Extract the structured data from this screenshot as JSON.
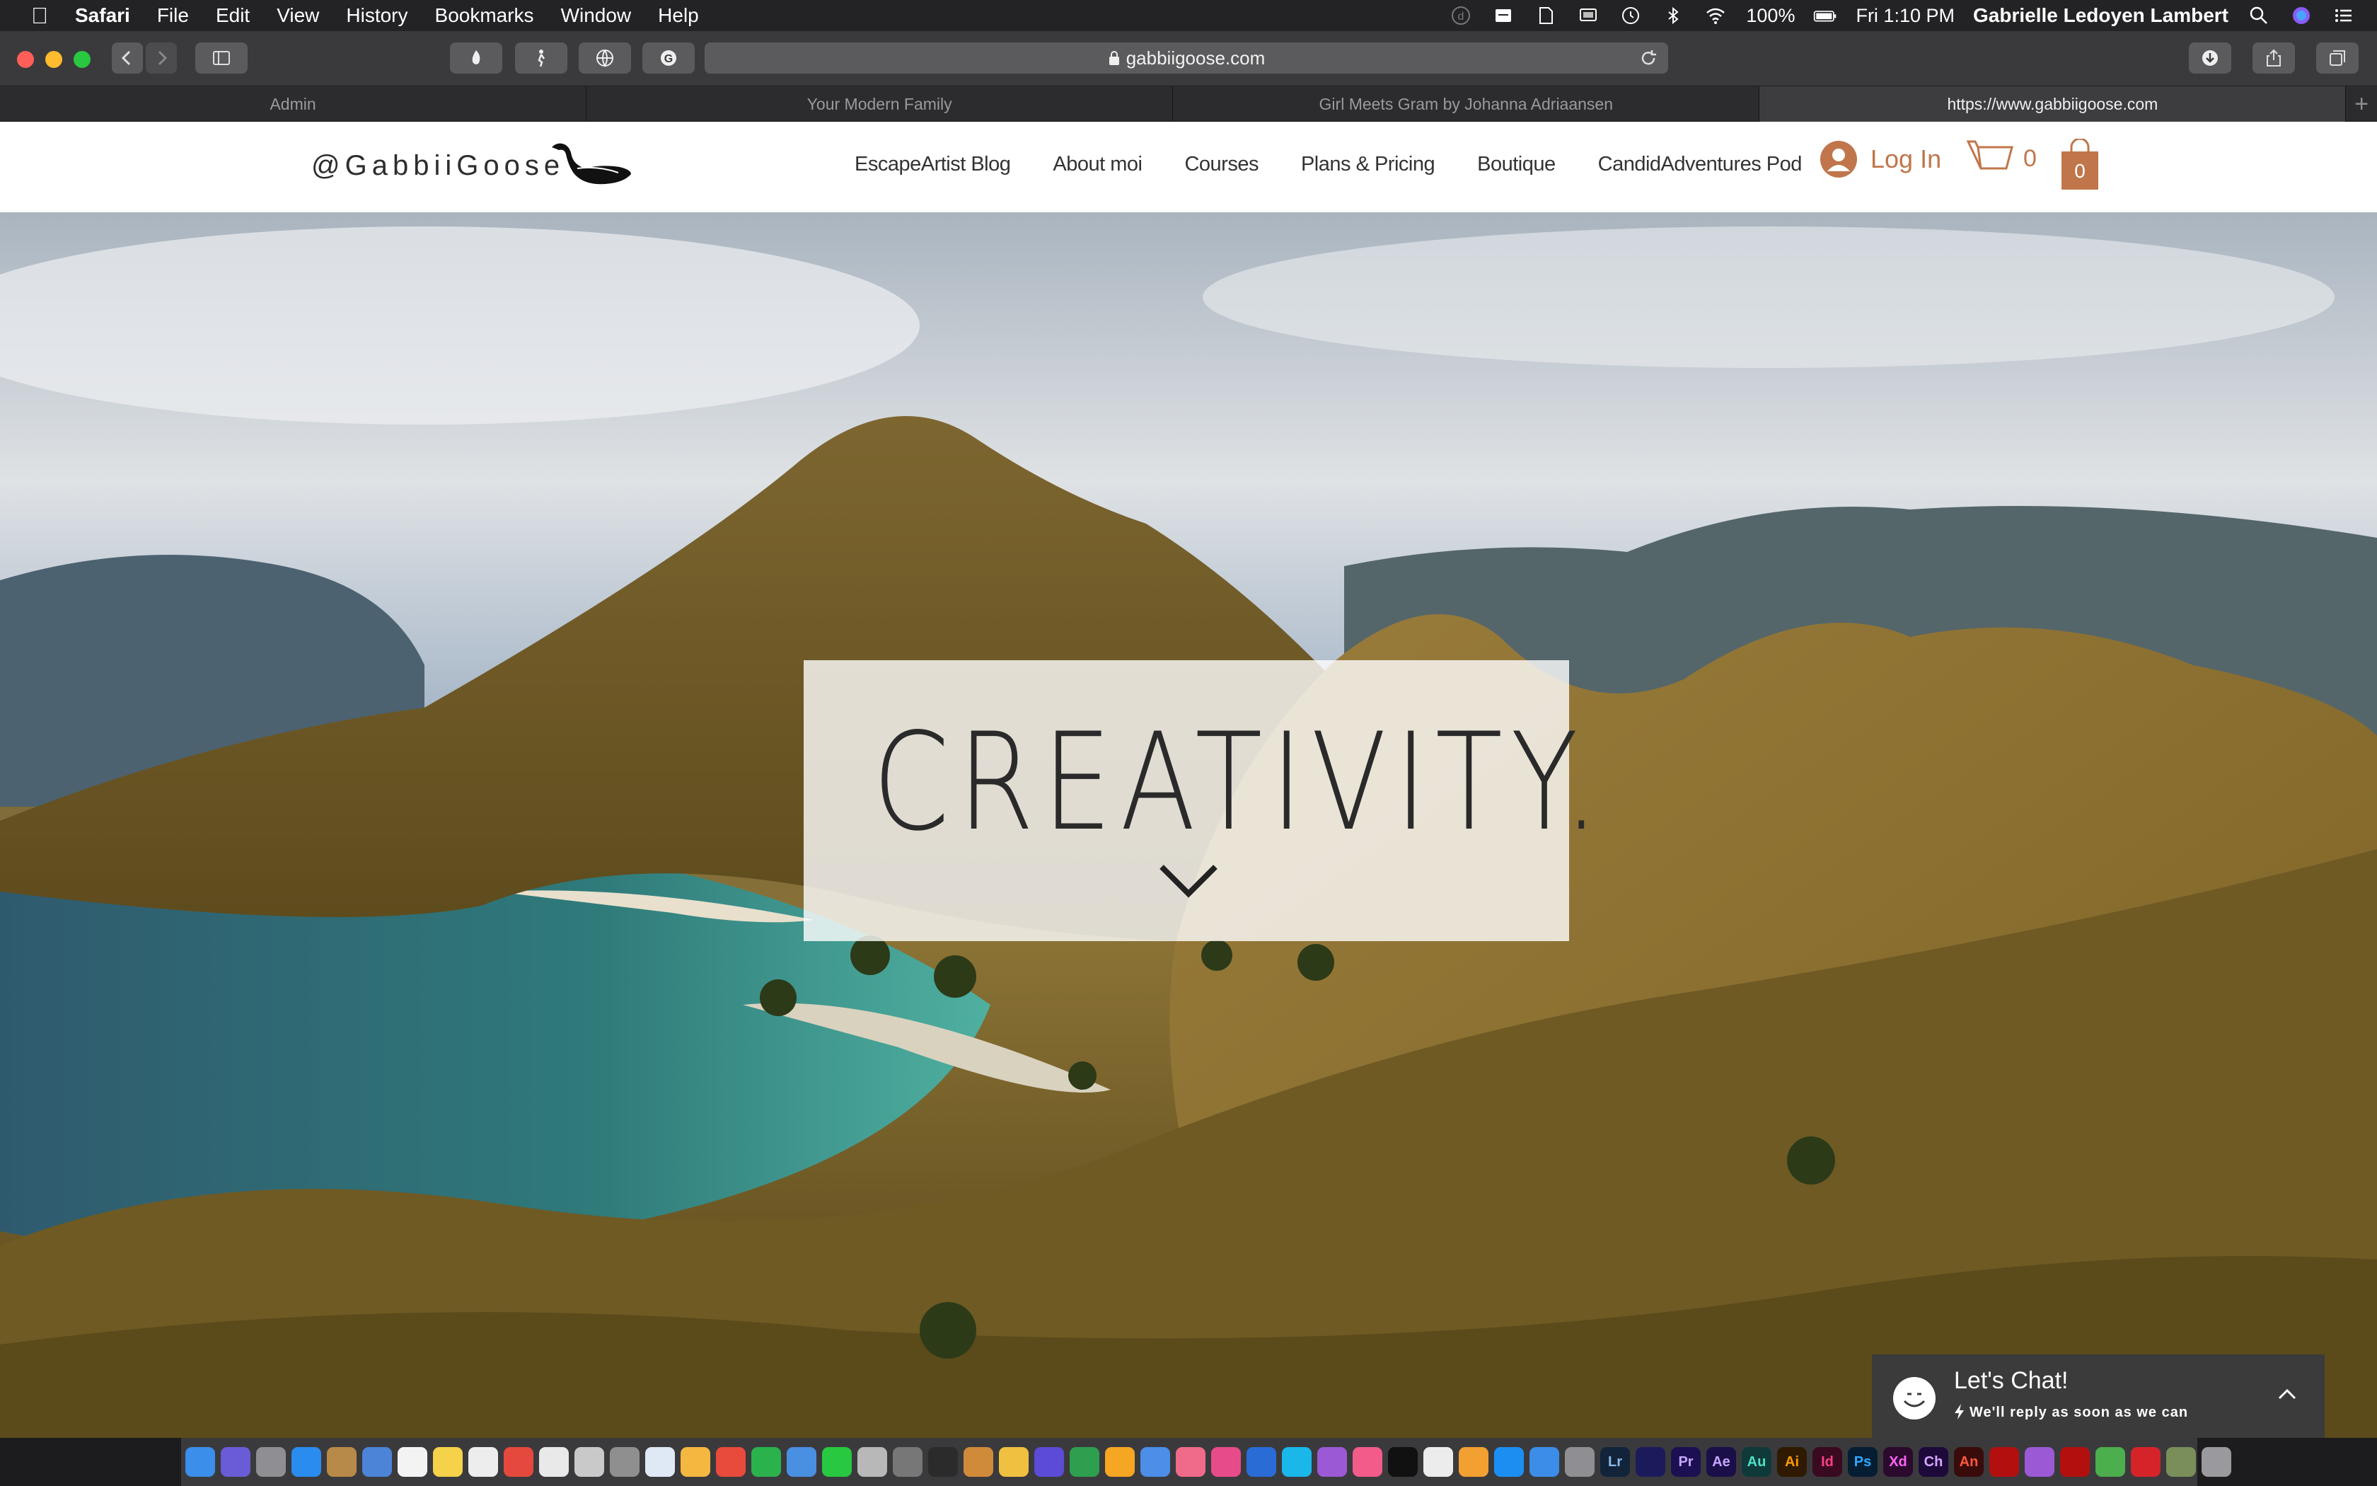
{
  "menubar": {
    "app": "Safari",
    "items": [
      "File",
      "Edit",
      "View",
      "History",
      "Bookmarks",
      "Window",
      "Help"
    ],
    "battery": "100%",
    "clock": "Fri 1:10 PM",
    "user": "Gabrielle Ledoyen Lambert"
  },
  "browser": {
    "url": "gabbiigoose.com",
    "tabs": [
      "Admin",
      "Your Modern Family",
      "Girl Meets Gram by Johanna Adriaansen",
      "https://www.gabbiigoose.com"
    ],
    "new_tab": "+"
  },
  "site": {
    "brand": "@GabbiiGoose",
    "nav": [
      "EscapeArtist Blog",
      "About moi",
      "Courses",
      "Plans & Pricing",
      "Boutique",
      "CandidAdventures Pod"
    ],
    "login": "Log In",
    "cart_count": "0",
    "bag_count": "0",
    "accent_color": "#c0764a"
  },
  "hero": {
    "headline": "CREATIVITY."
  },
  "chat": {
    "title": "Let's Chat!",
    "subtitle": "We'll reply as soon as we can"
  }
}
